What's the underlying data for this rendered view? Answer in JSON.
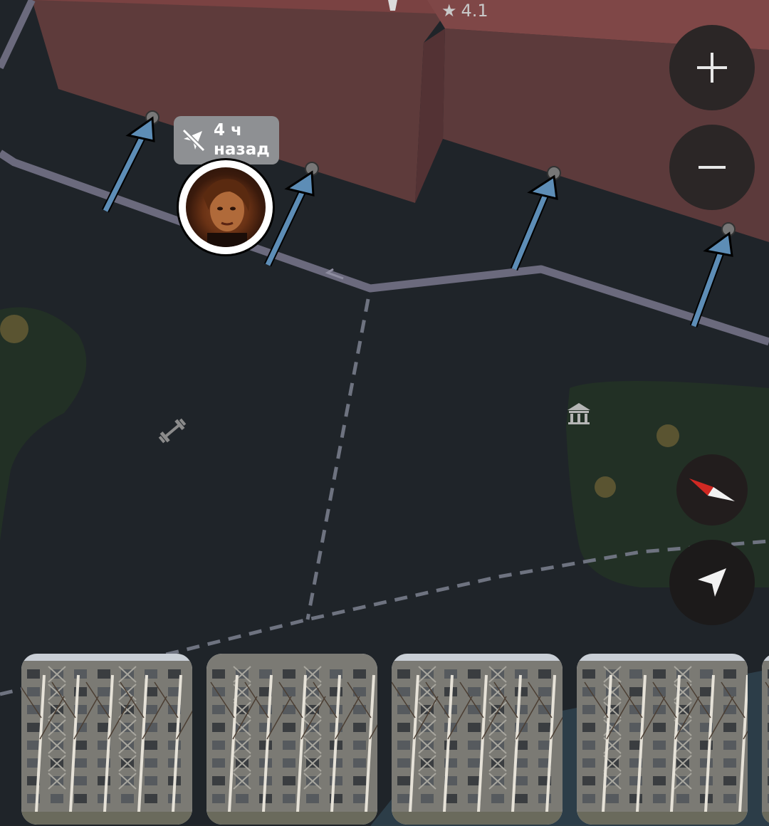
{
  "place": {
    "rating": "4.1",
    "star_icon": "star-icon"
  },
  "friend": {
    "last_seen": [
      "4 ч",
      "назад"
    ],
    "status_icon": "offline-location-icon"
  },
  "controls": {
    "zoom_in": {
      "icon": "plus-icon"
    },
    "zoom_out": {
      "icon": "minus-icon"
    },
    "compass": {
      "icon": "compass-icon"
    },
    "locate": {
      "icon": "navigation-arrow-icon"
    }
  },
  "poi": [
    {
      "kind": "gym",
      "icon": "dumbbell-icon"
    },
    {
      "kind": "museum",
      "icon": "museum-icon"
    }
  ],
  "photos": [
    {
      "name": "building-photo-1"
    },
    {
      "name": "building-photo-2"
    },
    {
      "name": "building-photo-3"
    },
    {
      "name": "building-photo-4"
    },
    {
      "name": "building-photo-5"
    }
  ],
  "colors": {
    "map_background": "#1f2429",
    "building": "#5e3b3b",
    "road": "#6b6a7d",
    "park": "#223025",
    "annotation_arrow": "#5d8db6"
  }
}
